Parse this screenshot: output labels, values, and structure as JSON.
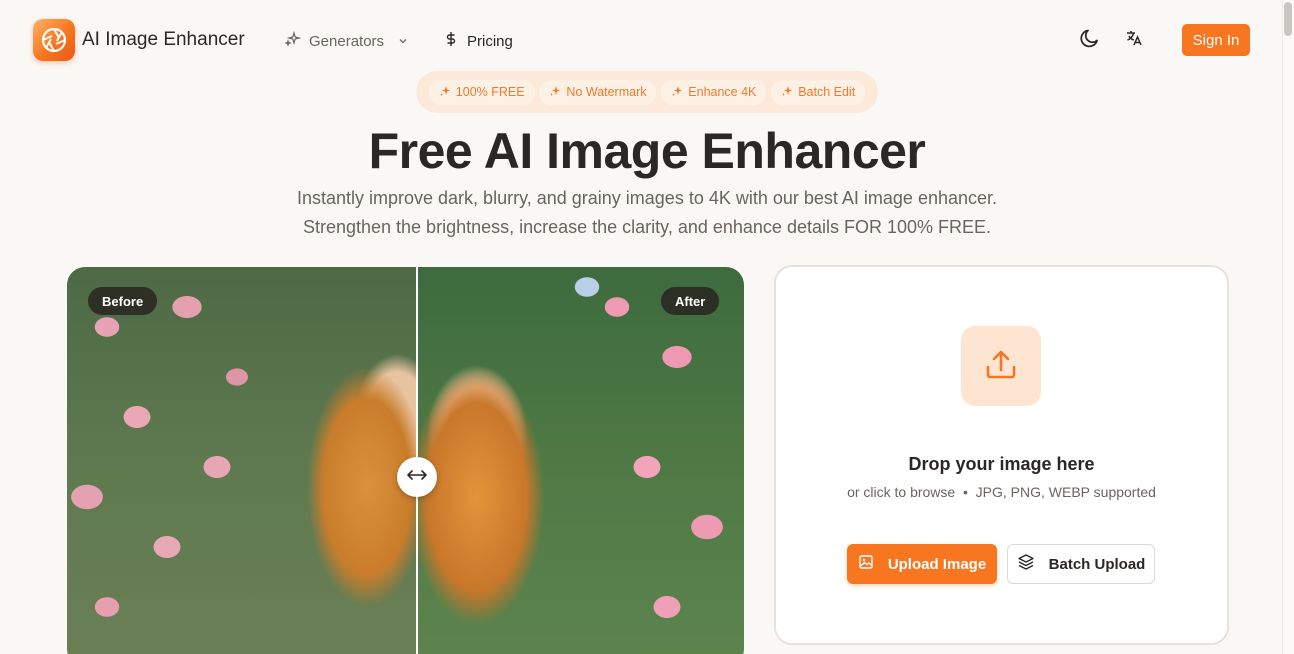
{
  "header": {
    "logo_text": "AI Image Enhancer",
    "nav": {
      "generators": "Generators",
      "pricing": "Pricing"
    },
    "sign_in": "Sign In"
  },
  "badges": [
    "100% FREE",
    "No Watermark",
    "Enhance 4K",
    "Batch Edit"
  ],
  "hero": {
    "title": "Free AI Image Enhancer",
    "subtitle_line1": "Instantly improve dark, blurry, and grainy images to 4K with our best AI image enhancer.",
    "subtitle_line2": "Strengthen the brightness, increase the clarity, and enhance details FOR 100% FREE."
  },
  "compare": {
    "before_label": "Before",
    "after_label": "After",
    "split": 0.52
  },
  "upload": {
    "title": "Drop your image here",
    "subtitle": "or click to browse  •  JPG, PNG, WEBP supported",
    "upload_button": "Upload Image",
    "batch_button": "Batch Upload"
  },
  "colors": {
    "accent": "#f7761f",
    "badge_bg": "#fde9da",
    "text": "#2a2724"
  }
}
